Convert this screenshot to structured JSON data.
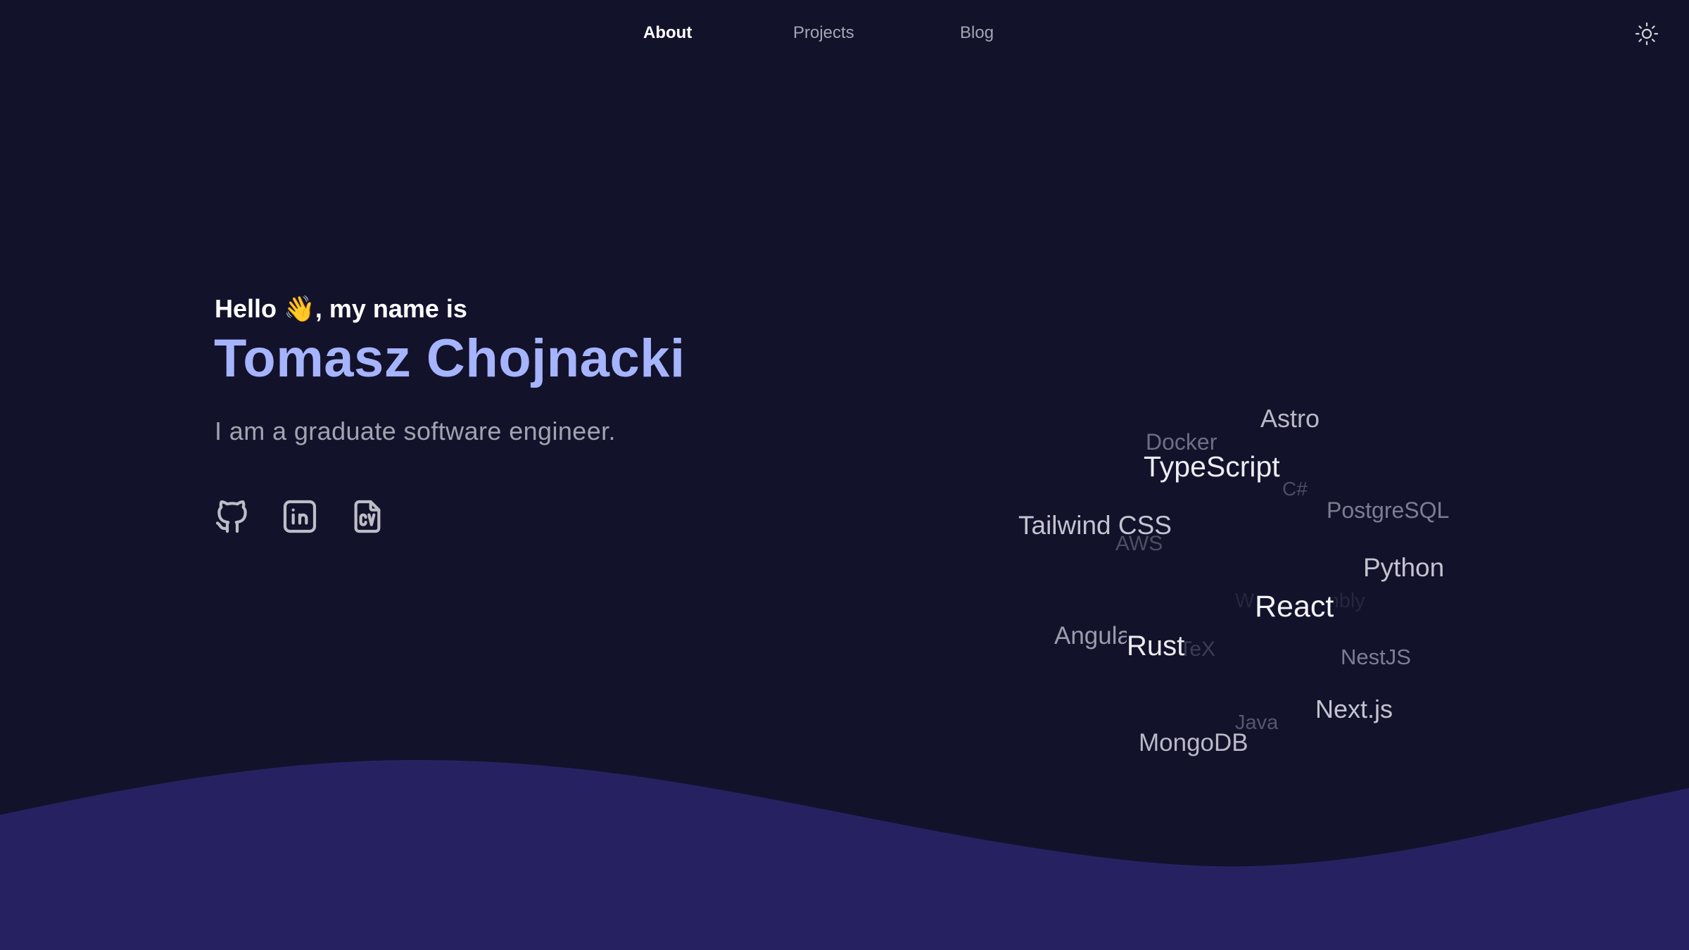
{
  "nav": {
    "links": [
      {
        "label": "About",
        "active": true
      },
      {
        "label": "Projects",
        "active": false
      },
      {
        "label": "Blog",
        "active": false
      }
    ],
    "theme_toggle_icon": "sun-icon"
  },
  "hero": {
    "greeting_prefix": "Hello ",
    "greeting_emoji": "👋",
    "greeting_suffix": ", my name is",
    "name": "Tomasz Chojnacki",
    "tagline": "I am a graduate software engineer.",
    "socials": [
      {
        "icon": "github-icon"
      },
      {
        "icon": "linkedin-icon"
      },
      {
        "icon": "cv-file-icon"
      }
    ]
  },
  "tag_cloud": {
    "tags": [
      "Astro",
      "Docker",
      "TypeScript",
      "C#",
      "PostgreSQL",
      "Tailwind CSS",
      "AWS",
      "Python",
      "WebAssembly",
      "React",
      "Angular",
      "Rust",
      "LaTeX",
      "NestJS",
      "Next.js",
      "Java",
      "MongoDB"
    ]
  },
  "colors": {
    "background": "#13122b",
    "accent": "#a5b4fc",
    "wave": "#262262"
  }
}
